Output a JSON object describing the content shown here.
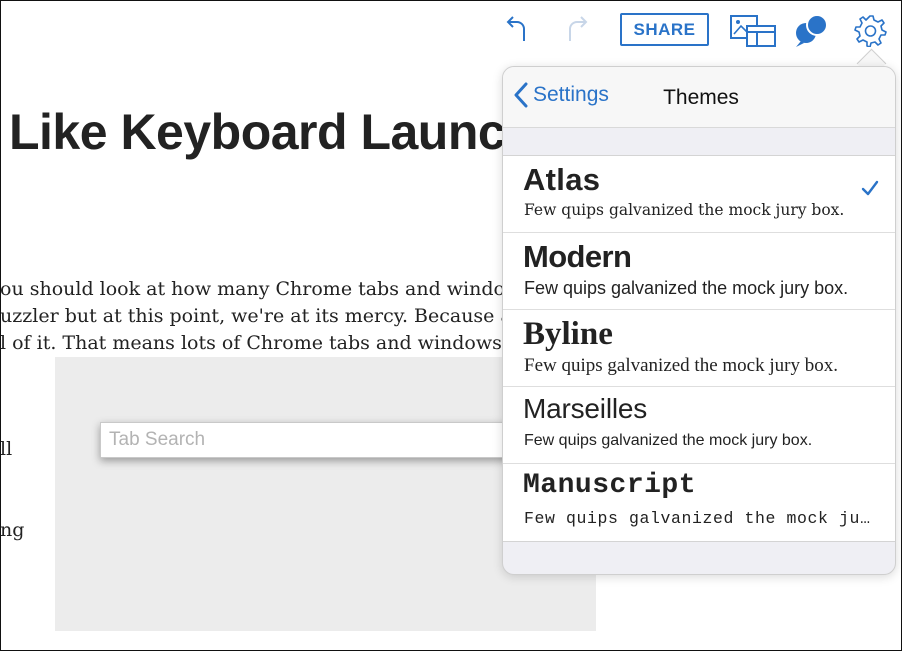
{
  "toolbar": {
    "share_label": "SHARE",
    "accent_color": "#2a73c8",
    "icons": [
      "undo-icon",
      "redo-icon",
      "layout-icon",
      "pin-icon",
      "gear-icon"
    ]
  },
  "article": {
    "headline": "Like Keyboard Launc",
    "lines": [
      "ou should look at how many Chrome tabs and windows I h",
      "uzzler but at this point, we're at its mercy. Because a lot of",
      "l of it. That means lots of Chrome tabs and windows."
    ],
    "fragments": [
      "ll",
      "ng"
    ],
    "tab_search_placeholder": "Tab Search"
  },
  "popover": {
    "back_label": "Settings",
    "title": "Themes",
    "themes": [
      {
        "name": "Atlas",
        "sample": "Few quips galvanized the mock jury box.",
        "selected": true
      },
      {
        "name": "Modern",
        "sample": "Few quips galvanized the mock jury box.",
        "selected": false
      },
      {
        "name": "Byline",
        "sample": "Few quips galvanized the mock jury box.",
        "selected": false
      },
      {
        "name": "Marseilles",
        "sample": "Few quips galvanized the mock jury box.",
        "selected": false
      },
      {
        "name": "Manuscript",
        "sample": "Few quips galvanized the mock jury box.",
        "selected": false
      }
    ]
  }
}
